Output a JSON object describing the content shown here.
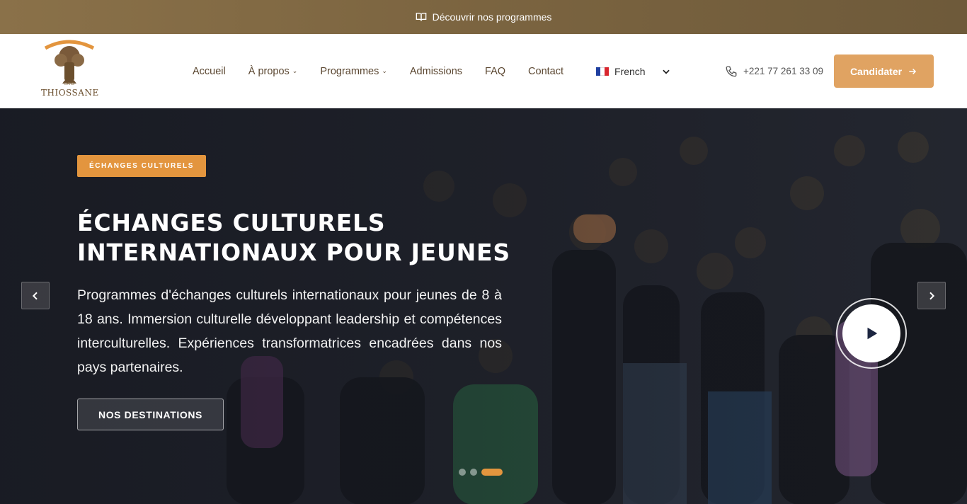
{
  "topbar": {
    "link_label": "Découvrir nos programmes",
    "icon": "book-open-icon"
  },
  "logo": {
    "small_text": "DANS",
    "name": "THIOSSANE"
  },
  "nav": {
    "items": [
      {
        "label": "Accueil",
        "has_dropdown": false
      },
      {
        "label": "À propos",
        "has_dropdown": true
      },
      {
        "label": "Programmes",
        "has_dropdown": true
      },
      {
        "label": "Admissions",
        "has_dropdown": false
      },
      {
        "label": "FAQ",
        "has_dropdown": false
      },
      {
        "label": "Contact",
        "has_dropdown": false
      }
    ]
  },
  "language": {
    "selected": "French",
    "flag": "france-flag-icon"
  },
  "contact": {
    "phone": "+221 77 261 33 09",
    "icon": "phone-icon"
  },
  "cta": {
    "label": "Candidater",
    "icon": "arrow-right-icon"
  },
  "hero": {
    "tag": "ÉCHANGES CULTURELS",
    "title_line1": "ÉCHANGES CULTURELS",
    "title_line2": "INTERNATIONAUX POUR JEUNES",
    "text": "Programmes d'échanges culturels internationaux pour jeunes de 8 à 18 ans. Immersion culturelle développant leadership et compétences interculturelles. Expériences transformatrices encadrées dans nos pays partenaires.",
    "button_label": "NOS DESTINATIONS",
    "slides_count": 3,
    "active_slide": 3
  },
  "colors": {
    "topbar": "#7b6440",
    "accent": "#e3953e",
    "cta": "#e0a362",
    "nav_text": "#5a4630"
  }
}
